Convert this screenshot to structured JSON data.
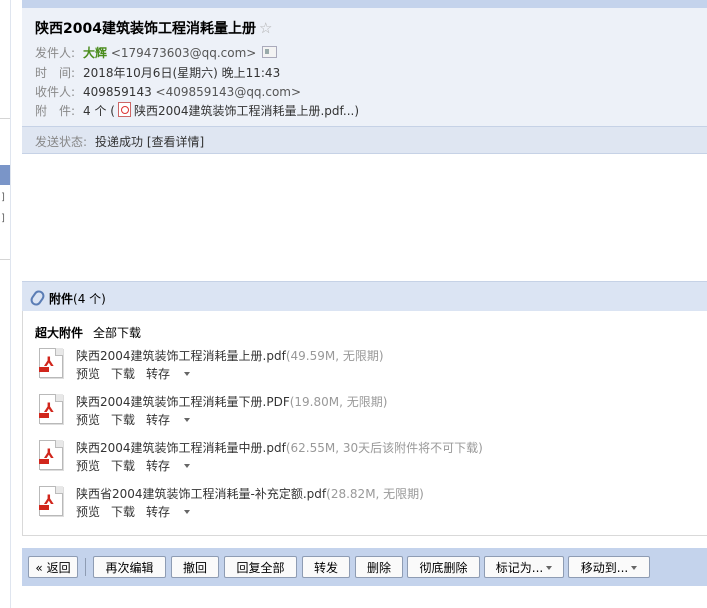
{
  "email": {
    "subject": "陕西2004建筑装饰工程消耗量上册",
    "star_glyph": "☆",
    "from": {
      "label": "发件人:",
      "name": "大辉",
      "address": "<179473603@qq.com>"
    },
    "time": {
      "label": "时　间:",
      "value": "2018年10月6日(星期六) 晚上11:43"
    },
    "to": {
      "label": "收件人:",
      "name": "409859143",
      "address": "<409859143@qq.com>"
    },
    "attach": {
      "label": "附　件:",
      "count": "4 个 (",
      "first": "陕西2004建筑装饰工程消耗量上册.pdf...)"
    },
    "send_status": {
      "label": "发送状态:",
      "value": "投递成功",
      "detail": "[查看详情]"
    }
  },
  "attachments": {
    "title": "附件",
    "count": "(4 个)",
    "super_label": "超大附件",
    "download_all": "全部下载",
    "files": [
      {
        "name": "陕西2004建筑装饰工程消耗量上册.pdf",
        "meta": "(49.59M, 无限期)"
      },
      {
        "name": "陕西2004建筑装饰工程消耗量下册.PDF",
        "meta": "(19.80M, 无限期)"
      },
      {
        "name": "陕西2004建筑装饰工程消耗量中册.pdf",
        "meta": "(62.55M, 30天后该附件将不可下载)"
      },
      {
        "name": "陕西省2004建筑装饰工程消耗量-补充定额.pdf",
        "meta": "(28.82M, 无限期)"
      }
    ],
    "actions": {
      "preview": "预览",
      "download": "下载",
      "save": "转存"
    }
  },
  "toolbar": {
    "back": "« 返回",
    "reedit": "再次编辑",
    "recall": "撤回",
    "reply_all": "回复全部",
    "forward": "转发",
    "delete": "删除",
    "delete_forever": "彻底删除",
    "mark_as": "标记为...",
    "move_to": "移动到..."
  },
  "left_rail": {
    "bracket": "]"
  },
  "colors": {
    "header_bg": "#edf1f8",
    "bar_bg": "#c4d3ec",
    "sender_green": "#4a8c1c",
    "pdf_red": "#d1261c"
  }
}
